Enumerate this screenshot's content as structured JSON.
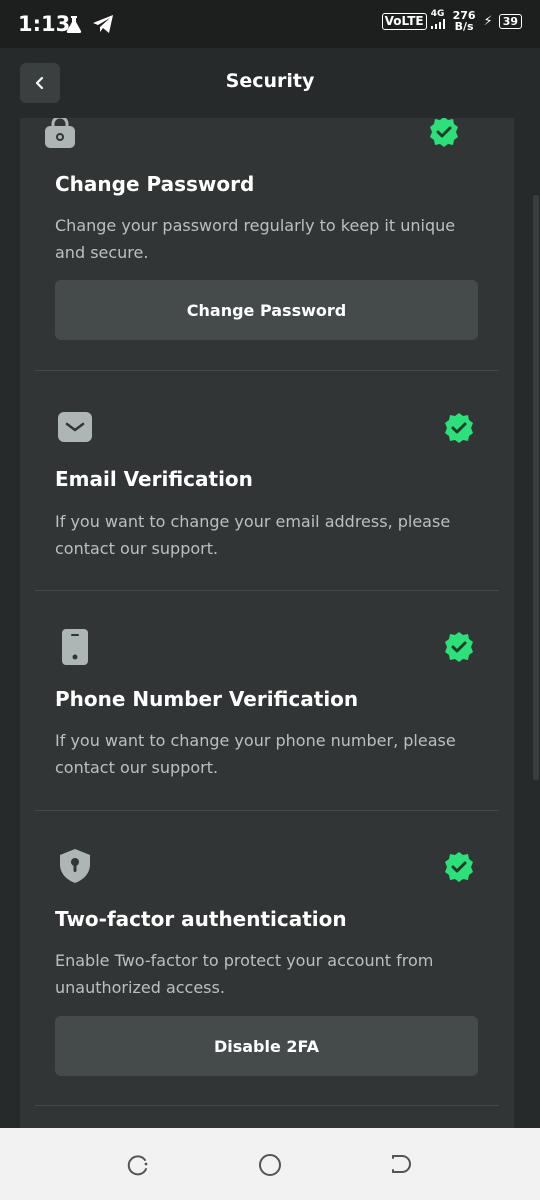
{
  "status_bar": {
    "time": "1:13",
    "network": "VoLTE",
    "network_type": "4G",
    "speed_value": "276",
    "speed_unit": "B/s",
    "battery": "39"
  },
  "header": {
    "title": "Security"
  },
  "sections": [
    {
      "icon": "lock-icon",
      "title": "Change Password",
      "description": "Change your password regularly to keep it unique and secure.",
      "button_label": "Change Password",
      "verified": true
    },
    {
      "icon": "mail-icon",
      "title": "Email Verification",
      "description": "If you want to change your email address, please contact our support.",
      "verified": true
    },
    {
      "icon": "phone-icon",
      "title": "Phone Number Verification",
      "description": "If you want to change your phone number, please contact our support.",
      "verified": true
    },
    {
      "icon": "shield-icon",
      "title": "Two-factor authentication",
      "description": "Enable Two-factor to protect your account from unauthorized access.",
      "button_label": "Disable 2FA",
      "verified": true
    }
  ],
  "colors": {
    "background": "#272a2a",
    "panel": "#323535",
    "button": "#454b4b",
    "accent_green": "#2ee07a",
    "text_muted": "#b9c0c0"
  }
}
